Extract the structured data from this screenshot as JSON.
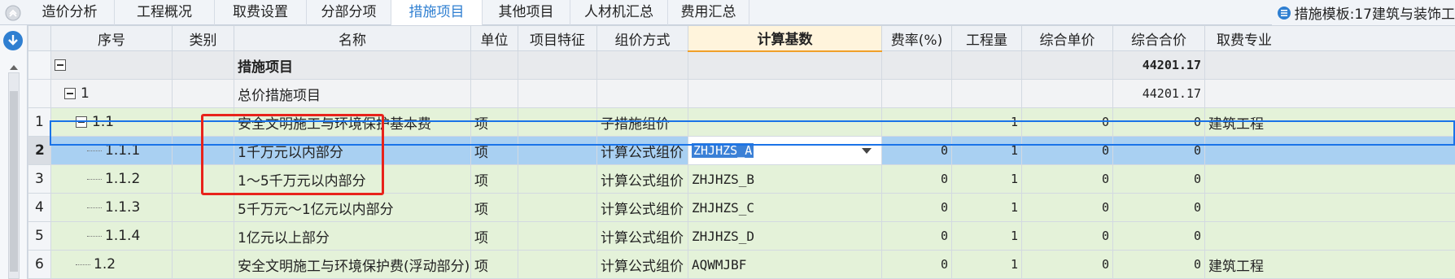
{
  "tabs": [
    {
      "label": "造价分析"
    },
    {
      "label": "工程概况"
    },
    {
      "label": "取费设置"
    },
    {
      "label": "分部分项"
    },
    {
      "label": "措施项目"
    },
    {
      "label": "其他项目"
    },
    {
      "label": "人材机汇总"
    },
    {
      "label": "费用汇总"
    }
  ],
  "active_tab": "措施项目",
  "template_label": "措施模板:17建筑与装饰工",
  "columns": [
    "序号",
    "类别",
    "名称",
    "单位",
    "项目特征",
    "组价方式",
    "计算基数",
    "费率(%)",
    "工程量",
    "综合单价",
    "综合合价",
    "取费专业"
  ],
  "highlight_column": "计算基数",
  "rows": [
    {
      "rownum": "",
      "code": "",
      "category": "",
      "name": "措施项目",
      "unit": "",
      "feature": "",
      "method": "",
      "base": "",
      "rate": "",
      "qty": "",
      "unit_price": "",
      "total": "44201.17",
      "profession": ""
    },
    {
      "rownum": "",
      "code": "1",
      "category": "",
      "name": "总价措施项目",
      "unit": "",
      "feature": "",
      "method": "",
      "base": "",
      "rate": "",
      "qty": "",
      "unit_price": "",
      "total": "44201.17",
      "profession": ""
    },
    {
      "rownum": "1",
      "code": "1.1",
      "category": "",
      "name": "安全文明施工与环境保护基本费",
      "unit": "项",
      "feature": "",
      "method": "子措施组价",
      "base": "",
      "rate": "",
      "qty": "1",
      "unit_price": "0",
      "total": "0",
      "profession": "建筑工程"
    },
    {
      "rownum": "2",
      "code": "1.1.1",
      "category": "",
      "name": "1千万元以内部分",
      "unit": "项",
      "feature": "",
      "method": "计算公式组价",
      "base": "ZHJHZS_A",
      "rate": "0",
      "qty": "1",
      "unit_price": "0",
      "total": "0",
      "profession": ""
    },
    {
      "rownum": "3",
      "code": "1.1.2",
      "category": "",
      "name": "1～5千万元以内部分",
      "unit": "项",
      "feature": "",
      "method": "计算公式组价",
      "base": "ZHJHZS_B",
      "rate": "0",
      "qty": "1",
      "unit_price": "0",
      "total": "0",
      "profession": ""
    },
    {
      "rownum": "4",
      "code": "1.1.3",
      "category": "",
      "name": "5千万元～1亿元以内部分",
      "unit": "项",
      "feature": "",
      "method": "计算公式组价",
      "base": "ZHJHZS_C",
      "rate": "0",
      "qty": "1",
      "unit_price": "0",
      "total": "0",
      "profession": ""
    },
    {
      "rownum": "5",
      "code": "1.1.4",
      "category": "",
      "name": "1亿元以上部分",
      "unit": "项",
      "feature": "",
      "method": "计算公式组价",
      "base": "ZHJHZS_D",
      "rate": "0",
      "qty": "1",
      "unit_price": "0",
      "total": "0",
      "profession": ""
    },
    {
      "rownum": "6",
      "code": "1.2",
      "category": "",
      "name": "安全文明施工与环境保护费(浮动部分)",
      "unit": "项",
      "feature": "",
      "method": "计算公式组价",
      "base": "AQWMJBF",
      "rate": "0",
      "qty": "1",
      "unit_price": "0",
      "total": "0",
      "profession": "建筑工程"
    }
  ],
  "colors": {
    "active_tab_text": "#2f7fd1",
    "selection": "#a9d0f2",
    "annotation_box": "#e8231b",
    "group_green": "#e4f2d9"
  }
}
